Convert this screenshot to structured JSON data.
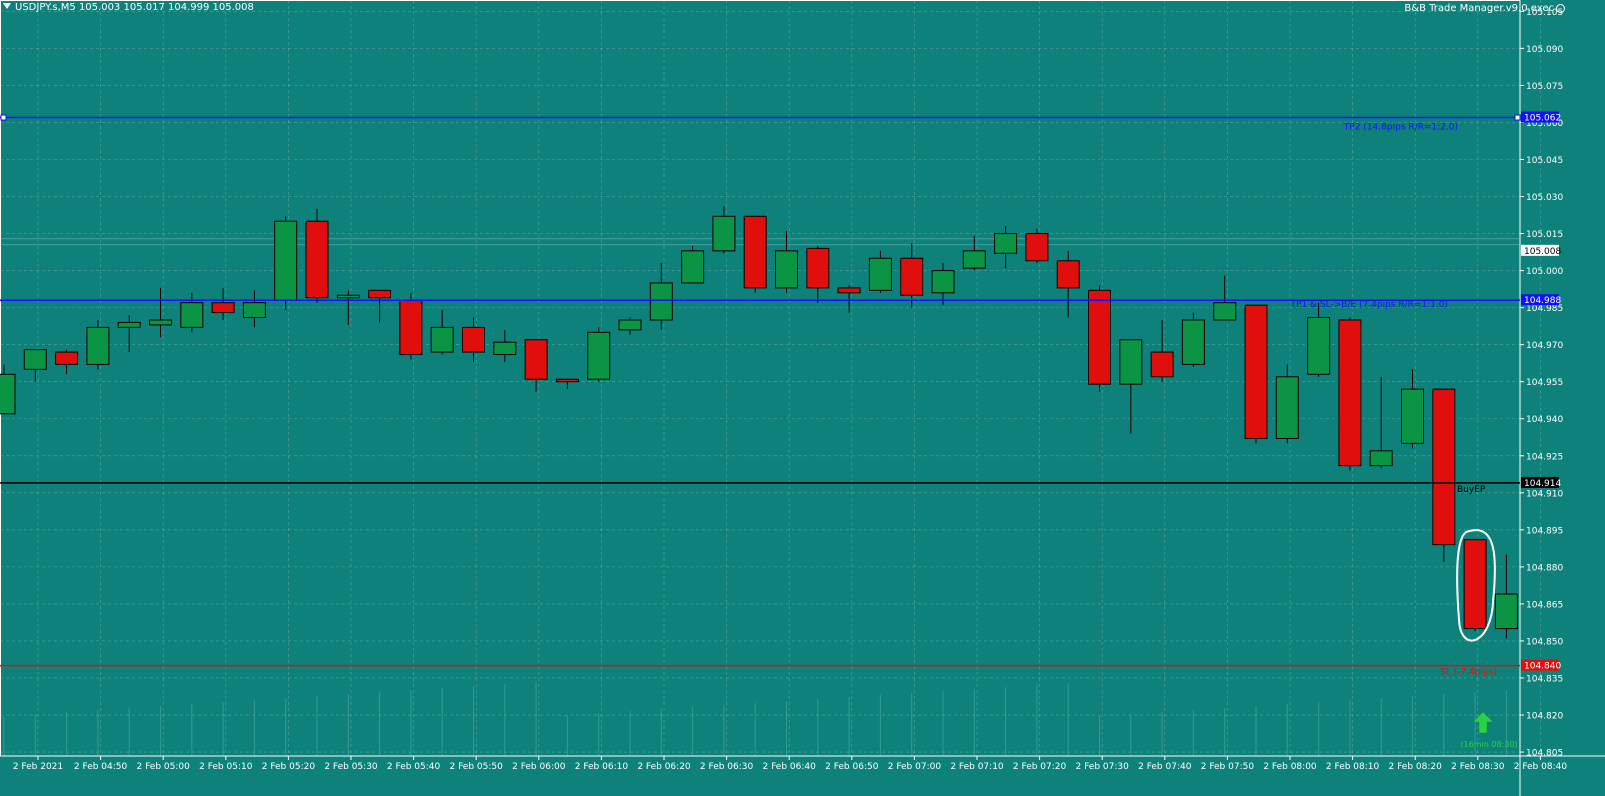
{
  "header": {
    "symbol_line": "USDJPY.s,M5  105.003 105.017 104.999 105.008",
    "ea_name": "B&B Trade Manager.v9.0.exec"
  },
  "colors": {
    "background": "#0e827a",
    "bull": "#0a9443",
    "bear": "#e10e0e",
    "grid": "#6fb7b0",
    "level_blue": "#1010ff",
    "level_black": "#000000",
    "level_red": "#e01010"
  },
  "chart_data": {
    "type": "candlestick",
    "timeframe": "M5",
    "x_tick_labels": [
      "2 Feb 2021",
      "2 Feb 04:50",
      "2 Feb 05:00",
      "2 Feb 05:10",
      "2 Feb 05:20",
      "2 Feb 05:30",
      "2 Feb 05:40",
      "2 Feb 05:50",
      "2 Feb 06:00",
      "2 Feb 06:10",
      "2 Feb 06:20",
      "2 Feb 06:30",
      "2 Feb 06:40",
      "2 Feb 06:50",
      "2 Feb 07:00",
      "2 Feb 07:10",
      "2 Feb 07:20",
      "2 Feb 07:30",
      "2 Feb 07:40",
      "2 Feb 07:50",
      "2 Feb 08:00",
      "2 Feb 08:10",
      "2 Feb 08:20",
      "2 Feb 08:30",
      "2 Feb 08:40"
    ],
    "y_tick_labels": [
      "105.105",
      "105.090",
      "105.075",
      "105.060",
      "105.045",
      "105.030",
      "105.015",
      "105.000",
      "104.985",
      "104.970",
      "104.955",
      "104.940",
      "104.925",
      "104.910",
      "104.895",
      "104.880",
      "104.865",
      "104.850",
      "104.835",
      "104.820",
      "104.805"
    ],
    "ylim": [
      104.8034,
      105.1096
    ],
    "grid": true,
    "candles": [
      {
        "o": 104.942,
        "h": 104.962,
        "l": 104.942,
        "c": 104.958
      },
      {
        "o": 104.96,
        "h": 104.968,
        "l": 104.955,
        "c": 104.968
      },
      {
        "o": 104.967,
        "h": 104.968,
        "l": 104.958,
        "c": 104.962
      },
      {
        "o": 104.962,
        "h": 104.98,
        "l": 104.96,
        "c": 104.977
      },
      {
        "o": 104.977,
        "h": 104.982,
        "l": 104.967,
        "c": 104.979
      },
      {
        "o": 104.978,
        "h": 104.993,
        "l": 104.973,
        "c": 104.98
      },
      {
        "o": 104.977,
        "h": 104.991,
        "l": 104.975,
        "c": 104.987
      },
      {
        "o": 104.987,
        "h": 104.993,
        "l": 104.98,
        "c": 104.983
      },
      {
        "o": 104.981,
        "h": 104.992,
        "l": 104.977,
        "c": 104.987
      },
      {
        "o": 104.988,
        "h": 105.022,
        "l": 104.984,
        "c": 105.02
      },
      {
        "o": 105.02,
        "h": 105.025,
        "l": 104.987,
        "c": 104.989
      },
      {
        "o": 104.989,
        "h": 104.992,
        "l": 104.978,
        "c": 104.99
      },
      {
        "o": 104.992,
        "h": 104.992,
        "l": 104.979,
        "c": 104.989
      },
      {
        "o": 104.988,
        "h": 104.991,
        "l": 104.964,
        "c": 104.966
      },
      {
        "o": 104.967,
        "h": 104.984,
        "l": 104.966,
        "c": 104.977
      },
      {
        "o": 104.977,
        "h": 104.981,
        "l": 104.963,
        "c": 104.967
      },
      {
        "o": 104.966,
        "h": 104.976,
        "l": 104.963,
        "c": 104.971
      },
      {
        "o": 104.972,
        "h": 104.972,
        "l": 104.951,
        "c": 104.956
      },
      {
        "o": 104.956,
        "h": 104.956,
        "l": 104.952,
        "c": 104.955
      },
      {
        "o": 104.956,
        "h": 104.977,
        "l": 104.955,
        "c": 104.975
      },
      {
        "o": 104.976,
        "h": 104.981,
        "l": 104.974,
        "c": 104.98
      },
      {
        "o": 104.98,
        "h": 105.003,
        "l": 104.976,
        "c": 104.995
      },
      {
        "o": 104.995,
        "h": 105.01,
        "l": 104.995,
        "c": 105.008
      },
      {
        "o": 105.008,
        "h": 105.026,
        "l": 105.007,
        "c": 105.022
      },
      {
        "o": 105.022,
        "h": 105.022,
        "l": 104.991,
        "c": 104.993
      },
      {
        "o": 104.993,
        "h": 105.016,
        "l": 104.991,
        "c": 105.008
      },
      {
        "o": 105.009,
        "h": 105.01,
        "l": 104.987,
        "c": 104.993
      },
      {
        "o": 104.993,
        "h": 104.994,
        "l": 104.983,
        "c": 104.991
      },
      {
        "o": 104.992,
        "h": 105.008,
        "l": 104.991,
        "c": 105.005
      },
      {
        "o": 105.005,
        "h": 105.011,
        "l": 104.985,
        "c": 104.99
      },
      {
        "o": 104.991,
        "h": 105.003,
        "l": 104.986,
        "c": 105.0
      },
      {
        "o": 105.001,
        "h": 105.014,
        "l": 105.0,
        "c": 105.008
      },
      {
        "o": 105.007,
        "h": 105.018,
        "l": 105.001,
        "c": 105.015
      },
      {
        "o": 105.015,
        "h": 105.017,
        "l": 105.003,
        "c": 105.004
      },
      {
        "o": 105.004,
        "h": 105.008,
        "l": 104.981,
        "c": 104.993
      },
      {
        "o": 104.992,
        "h": 104.994,
        "l": 104.951,
        "c": 104.954
      },
      {
        "o": 104.954,
        "h": 104.97,
        "l": 104.934,
        "c": 104.972
      },
      {
        "o": 104.967,
        "h": 104.98,
        "l": 104.955,
        "c": 104.957
      },
      {
        "o": 104.962,
        "h": 104.983,
        "l": 104.961,
        "c": 104.98
      },
      {
        "o": 104.98,
        "h": 104.998,
        "l": 104.98,
        "c": 104.987
      },
      {
        "o": 104.986,
        "h": 104.986,
        "l": 104.93,
        "c": 104.932
      },
      {
        "o": 104.932,
        "h": 104.962,
        "l": 104.93,
        "c": 104.957
      },
      {
        "o": 104.958,
        "h": 104.987,
        "l": 104.957,
        "c": 104.981
      },
      {
        "o": 104.98,
        "h": 104.981,
        "l": 104.919,
        "c": 104.921
      },
      {
        "o": 104.921,
        "h": 104.957,
        "l": 104.92,
        "c": 104.927
      },
      {
        "o": 104.93,
        "h": 104.96,
        "l": 104.928,
        "c": 104.952
      },
      {
        "o": 104.952,
        "h": 104.952,
        "l": 104.882,
        "c": 104.889
      },
      {
        "o": 104.891,
        "h": 104.891,
        "l": 104.854,
        "c": 104.855
      },
      {
        "o": 104.855,
        "h": 104.885,
        "l": 104.851,
        "c": 104.869
      }
    ],
    "volume_ticks": true,
    "lines": [
      {
        "name": "TP2",
        "price": 105.062,
        "price_label": "105.062",
        "text": "TP2 (14.8pips R/R=1:2.0)",
        "color": "#1010ff"
      },
      {
        "name": "TP1",
        "price": 104.988,
        "price_label": "104.988",
        "text": "TP1 & SL->B/E (7.4pips R/R=1:1.0)",
        "color": "#1010ff"
      },
      {
        "name": "BuyEP",
        "price": 104.914,
        "price_label": "104.914",
        "text": "BuyEP",
        "color": "#000000"
      },
      {
        "name": "SL",
        "price": 104.84,
        "price_label": "104.840",
        "text": "SL (-7.4pips)",
        "color": "#e01010"
      }
    ],
    "current_price": {
      "price": 105.008,
      "label": "105.008"
    },
    "highlighted_candle": 47,
    "timer_text": "(16min 08:30)"
  }
}
